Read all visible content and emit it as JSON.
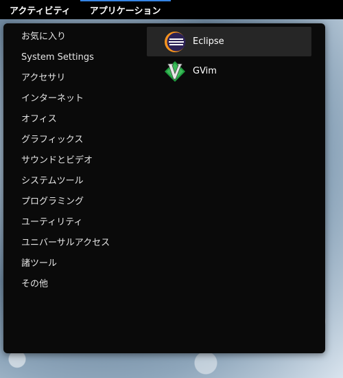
{
  "topbar": {
    "activities_label": "アクティビティ",
    "applications_label": "アプリケーション"
  },
  "categories": [
    "お気に入り",
    "System Settings",
    "アクセサリ",
    "インターネット",
    "オフィス",
    "グラフィックス",
    "サウンドとビデオ",
    "システムツール",
    "プログラミング",
    "ユーティリティ",
    "ユニバーサルアクセス",
    "諸ツール",
    "その他"
  ],
  "apps": [
    {
      "name": "Eclipse",
      "icon": "eclipse-icon",
      "selected": true
    },
    {
      "name": "GVim",
      "icon": "gvim-icon",
      "selected": false
    }
  ],
  "colors": {
    "accent": "#3584e4",
    "menu_bg": "#0a0a0a",
    "selected_bg": "#262626"
  }
}
